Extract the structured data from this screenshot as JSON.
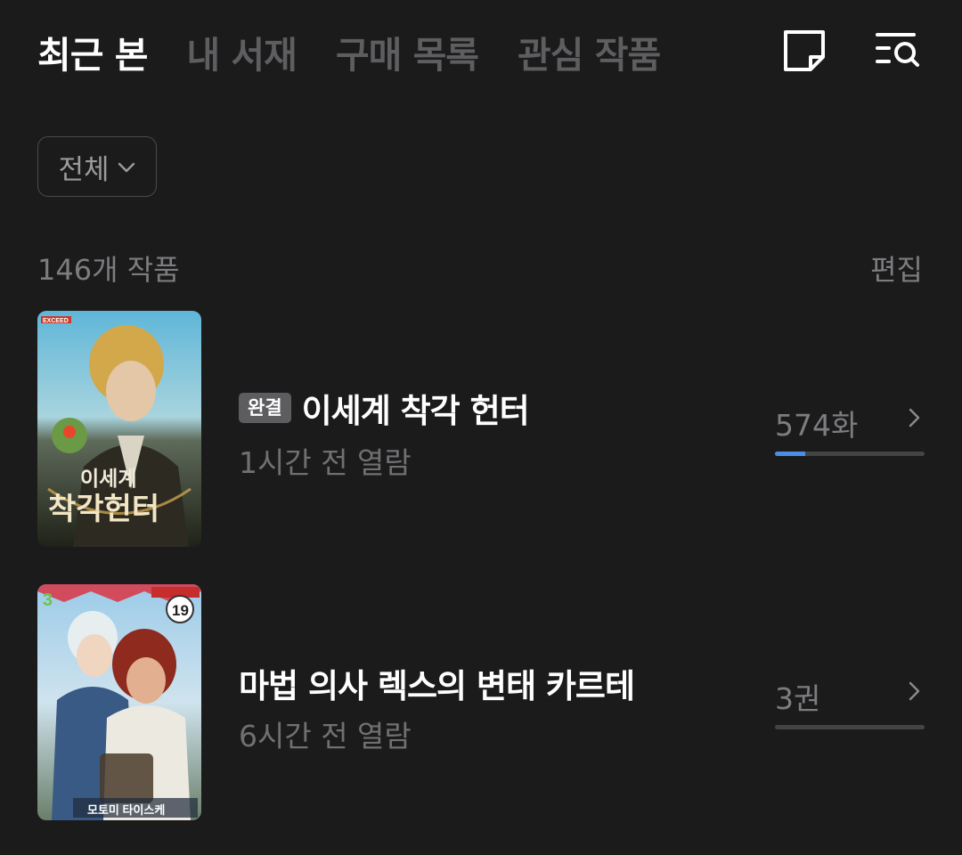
{
  "tabs": [
    {
      "label": "최근 본",
      "active": true
    },
    {
      "label": "내 서재",
      "active": false
    },
    {
      "label": "구매 목록",
      "active": false
    },
    {
      "label": "관심 작품",
      "active": false
    }
  ],
  "icons": {
    "memo": "memo-note-icon",
    "search_list": "list-search-icon"
  },
  "filter": {
    "label": "전체"
  },
  "list": {
    "count_label": "146개 작품",
    "edit_label": "편집"
  },
  "items": [
    {
      "badge": "완결",
      "title": "이세계 착각 헌터",
      "meta": "1시간 전 열람",
      "episode": "574화",
      "progress": 0.2,
      "cover_text": {
        "label": "EXCEED",
        "title_line1": "이세계",
        "title_line2": "착각헌터"
      }
    },
    {
      "badge": "",
      "title": "마법 의사 렉스의 변태 카르테",
      "meta": "6시간 전 열람",
      "episode": "3권",
      "progress": 0,
      "cover_text": {
        "volume": "3",
        "rating": "19",
        "author": "모토미 타이스케"
      }
    }
  ],
  "colors": {
    "background": "#1b1b1c",
    "accent": "#4a8ee6",
    "muted": "#7d7d80"
  }
}
